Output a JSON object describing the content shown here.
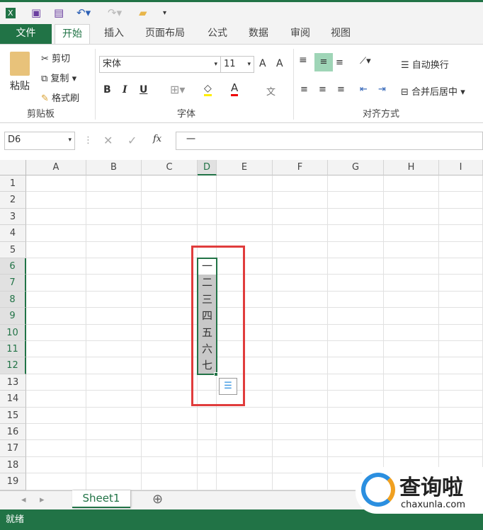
{
  "qat": {
    "icons": [
      "excel-logo-icon",
      "save-icon",
      "save-as-icon",
      "undo-icon",
      "redo-icon",
      "open-folder-icon",
      "customize-icon"
    ]
  },
  "tabs": [
    "文件",
    "开始",
    "插入",
    "页面布局",
    "公式",
    "数据",
    "审阅",
    "视图"
  ],
  "ribbon": {
    "clipboard": {
      "paste": "粘贴",
      "cut": "剪切",
      "copy": "复制",
      "format_painter": "格式刷",
      "group": "剪贴板"
    },
    "font": {
      "name": "宋体",
      "size": "11",
      "bold": "B",
      "italic": "I",
      "underline": "U",
      "grow": "A",
      "shrink": "A",
      "font_color": "A",
      "phonetic": "文",
      "group": "字体"
    },
    "alignment": {
      "wrap": "自动换行",
      "merge": "合并后居中",
      "group": "对齐方式"
    }
  },
  "formula_bar": {
    "name_box": "D6",
    "fx": "fx",
    "value": "一"
  },
  "columns": [
    "A",
    "B",
    "C",
    "D",
    "E",
    "F",
    "G",
    "H",
    "I"
  ],
  "rows": [
    "1",
    "2",
    "3",
    "4",
    "5",
    "6",
    "7",
    "8",
    "9",
    "10",
    "11",
    "12",
    "13",
    "14",
    "15",
    "16",
    "17",
    "18",
    "19"
  ],
  "cells": [
    "一",
    "二",
    "三",
    "四",
    "五",
    "六",
    "七"
  ],
  "sheet_tab": "Sheet1",
  "status": "就绪",
  "watermark": {
    "brand": "查询啦",
    "url": "chaxunla.com"
  },
  "colors": {
    "accent": "#217346",
    "highlight": "#e03c3c"
  }
}
